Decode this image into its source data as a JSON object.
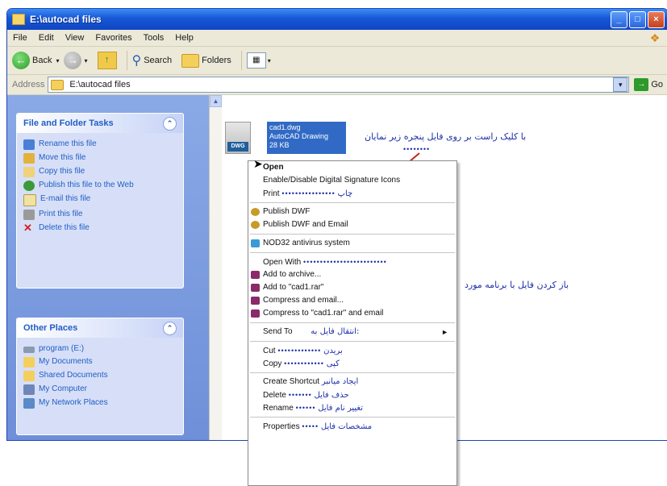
{
  "window": {
    "title": "E:\\autocad files",
    "buttons": {
      "minimize": "_",
      "maximize": "□",
      "close": "×"
    }
  },
  "menubar": {
    "items": [
      "File",
      "Edit",
      "View",
      "Favorites",
      "Tools",
      "Help"
    ]
  },
  "toolbar": {
    "back_label": "Back",
    "search_label": "Search",
    "folders_label": "Folders",
    "view_label": "▦"
  },
  "address": {
    "label": "Address",
    "value": "E:\\autocad files",
    "go_label": "Go"
  },
  "left_pane": {
    "tasks": {
      "title": "File and Folder Tasks",
      "items": [
        {
          "label": "Rename this file",
          "icon": "rename-icon",
          "color": "#4a7fd6"
        },
        {
          "label": "Move this file",
          "icon": "move-icon",
          "color": "#e2b23a"
        },
        {
          "label": "Copy this file",
          "icon": "copy-icon",
          "color": "#f0d27a"
        },
        {
          "label": "Publish this file to the Web",
          "icon": "globe-icon",
          "color": "#3a9a3a"
        },
        {
          "label": "E-mail this file",
          "icon": "email-icon",
          "color": "#f0e2a0"
        },
        {
          "label": "Print this file",
          "icon": "printer-icon",
          "color": "#9a9a9a"
        },
        {
          "label": "Delete this file",
          "icon": "delete-icon",
          "color": "#d21f1f"
        }
      ]
    },
    "other_places": {
      "title": "Other Places",
      "items": [
        {
          "label": "program (E:)",
          "icon": "drive-icon",
          "color": "#8a9ab0"
        },
        {
          "label": "My Documents",
          "icon": "folder-icon",
          "color": "#f4cf5b"
        },
        {
          "label": "Shared Documents",
          "icon": "folder-icon",
          "color": "#f4cf5b"
        },
        {
          "label": "My Computer",
          "icon": "computer-icon",
          "color": "#6f86b8"
        },
        {
          "label": "My Network Places",
          "icon": "network-icon",
          "color": "#5a8ac8"
        }
      ]
    }
  },
  "file": {
    "icon_badge": "DWG",
    "name": "cad1.dwg",
    "type": "AutoCAD Drawing",
    "size": "28 KB"
  },
  "annotations": {
    "top": "با کلیک راست بر روی فایل پنجره زیر نمایان",
    "open_with": "باز کردن فایل با برنامه مورد"
  },
  "context_menu": {
    "items": [
      {
        "label": "Open",
        "bold": true,
        "group": 0
      },
      {
        "label": "Enable/Disable Digital Signature Icons",
        "group": 0
      },
      {
        "label": "Print",
        "fa": "چاپ",
        "dots": "••••••••••••••••",
        "group": 0
      },
      {
        "label": "Publish DWF",
        "group": 1,
        "icon_color": "#c79a2a"
      },
      {
        "label": "Publish DWF and Email",
        "group": 1,
        "icon_color": "#c79a2a"
      },
      {
        "label": "NOD32 antivirus system",
        "group": 2,
        "icon_color": "#3a9ad6"
      },
      {
        "label": "Open With",
        "dots": "•••••••••••••••••••••••••",
        "group": 3
      },
      {
        "label": "Add to archive...",
        "group": 3,
        "icon_color": "#8a2a6a"
      },
      {
        "label": "Add to \"cad1.rar\"",
        "group": 3,
        "icon_color": "#8a2a6a"
      },
      {
        "label": "Compress and email...",
        "group": 3,
        "icon_color": "#8a2a6a"
      },
      {
        "label": "Compress to \"cad1.rar\" and email",
        "group": 3,
        "icon_color": "#8a2a6a"
      },
      {
        "label": "Send To",
        "fa": "انتقال فایل به:",
        "group": 4,
        "submenu": "►"
      },
      {
        "label": "Cut",
        "fa": "بریدن",
        "dots": "•••••••••••••",
        "group": 5
      },
      {
        "label": "Copy",
        "fa": "کپی",
        "dots": "••••••••••••",
        "group": 5
      },
      {
        "label": "Create Shortcut",
        "fa": "ایجاد میانبر",
        "group": 6
      },
      {
        "label": "Delete",
        "fa": "حذف فایل",
        "dots": "•••••••",
        "group": 6
      },
      {
        "label": "Rename",
        "fa": "تغییر نام فایل",
        "dots": "••••••",
        "group": 6
      },
      {
        "label": "Properties",
        "fa": "مشخصات فایل",
        "dots": "•••••",
        "group": 7
      }
    ]
  }
}
